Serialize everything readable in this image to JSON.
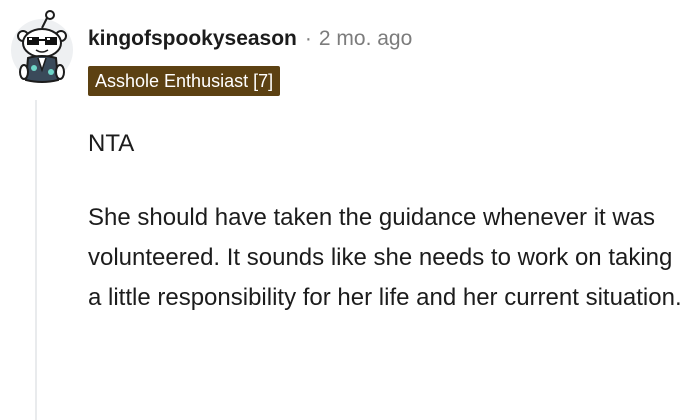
{
  "comment": {
    "author": "kingofspookyseason",
    "separator": "·",
    "timestamp": "2 mo. ago",
    "flair": "Asshole Enthusiast [7]",
    "paragraphs": [
      "NTA",
      "She should have taken the guidance whenever it was volunteered. It sounds like she needs to work on taking a little responsibility for her life and her current situation."
    ]
  },
  "colors": {
    "flair_background": "#5c4112",
    "text": "#1c1c1c",
    "muted_text": "#7c7c7c",
    "thread_line": "#e9ebed"
  },
  "icons": {
    "avatar": "snoo-avatar-sunglasses-icon"
  }
}
